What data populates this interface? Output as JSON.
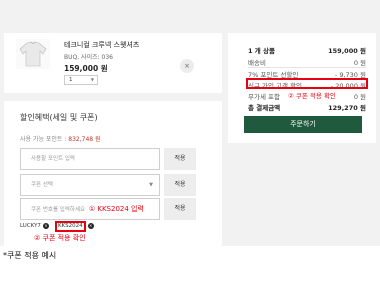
{
  "product": {
    "name": "테크니컬 크루넥 스웻셔츠",
    "option": "BUQ, 사이즈: 036",
    "price": "159,000 원",
    "quantity": "1",
    "remove_label": "×"
  },
  "discount": {
    "title": "할인혜택(세일 및 쿠폰)",
    "points_label": "사용 가능 포인트 : ",
    "points_value": "832,748 원",
    "point_input_placeholder": "사용할 포인트 입력",
    "point_apply": "적용",
    "coupon_select_placeholder": "쿠폰 선택",
    "coupon_select_apply": "적용",
    "coupon_code_placeholder": "쿠폰 번호를 입력하세요",
    "coupon_code_annotation": "① KKS2024 입력",
    "coupon_code_apply": "적용",
    "applied_prefix": "LUCKY7",
    "applied_code": "KKS2024",
    "applied_annotation": "② 쿠폰 적용 확인"
  },
  "summary": {
    "rows": [
      {
        "label": "1 개 상품",
        "value": "159,000 원"
      },
      {
        "label": "배송비",
        "value": "0 원"
      },
      {
        "label": "7% 포인트 선할인",
        "value": "- 9,730 원"
      },
      {
        "label": "신규 가입 고객 할인",
        "value": "- 20,000 원"
      },
      {
        "label": "무가세 포함",
        "value": "0 원"
      },
      {
        "label": "총 결제금액",
        "value": "129,270 원"
      }
    ],
    "annotation": "② 쿠폰 적용 확인",
    "order_button": "주문하기"
  },
  "caption": "*쿠폰 적용 예시",
  "colors": {
    "accent_green": "#1f5a3e",
    "annotation_red": "#e60012",
    "background": "#f2f2f2"
  }
}
